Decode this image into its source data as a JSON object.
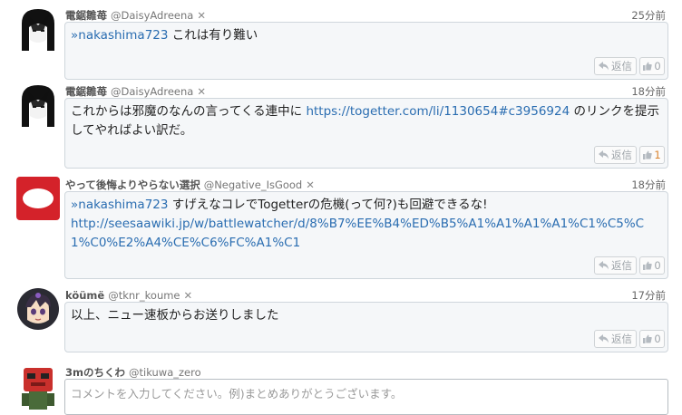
{
  "comments": [
    {
      "user_name": "電鋸雛苺",
      "user_id": "@DaisyAdreena",
      "close": "✕",
      "time": "25分前",
      "reply_link": "»nakashima723",
      "text": "これは有り難い",
      "reply_label": "返信",
      "like_count": "0",
      "avatar": "dark-hair-girl"
    },
    {
      "user_name": "電鋸雛苺",
      "user_id": "@DaisyAdreena",
      "close": "✕",
      "time": "18分前",
      "text_before": "これからは邪魔のなんの言ってくる連中に",
      "link": "https://togetter.com/li/1130654#c3956924",
      "text_after": "のリンクを提示してやればよい訳だ。",
      "reply_label": "返信",
      "like_count": "1",
      "avatar": "dark-hair-girl"
    },
    {
      "user_name": "やって後悔よりやらない選択",
      "user_id": "@Negative_IsGood",
      "close": "✕",
      "time": "18分前",
      "reply_link": "»nakashima723",
      "text": "すげえなコレでTogetterの危機(って何?)も回避できるな!",
      "link": "http://seesaawiki.jp/w/battlewatcher/d/8%B7%EE%B4%ED%B5%A1%A1%A1%A1%C1%C5%C1%C0%E2%A4%CE%C6%FC%A1%C1",
      "reply_label": "返信",
      "like_count": "0",
      "avatar": "red-oval"
    },
    {
      "user_name": "köümë",
      "user_id": "@tknr_koume",
      "close": "✕",
      "time": "17分前",
      "text": "以上、ニュー速板からお送りしました",
      "reply_label": "返信",
      "like_count": "0",
      "avatar": "anime-face"
    }
  ],
  "compose": {
    "user_name": "3mのちくわ",
    "user_id": "@tikuwa_zero",
    "placeholder": "コメントを入力してください。例)まとめありがとうございます。",
    "avatar": "red-robot"
  },
  "colors": {
    "link": "#2a6db1",
    "bubble_bg": "#f5f7f9",
    "like_active": "#d9822b"
  }
}
